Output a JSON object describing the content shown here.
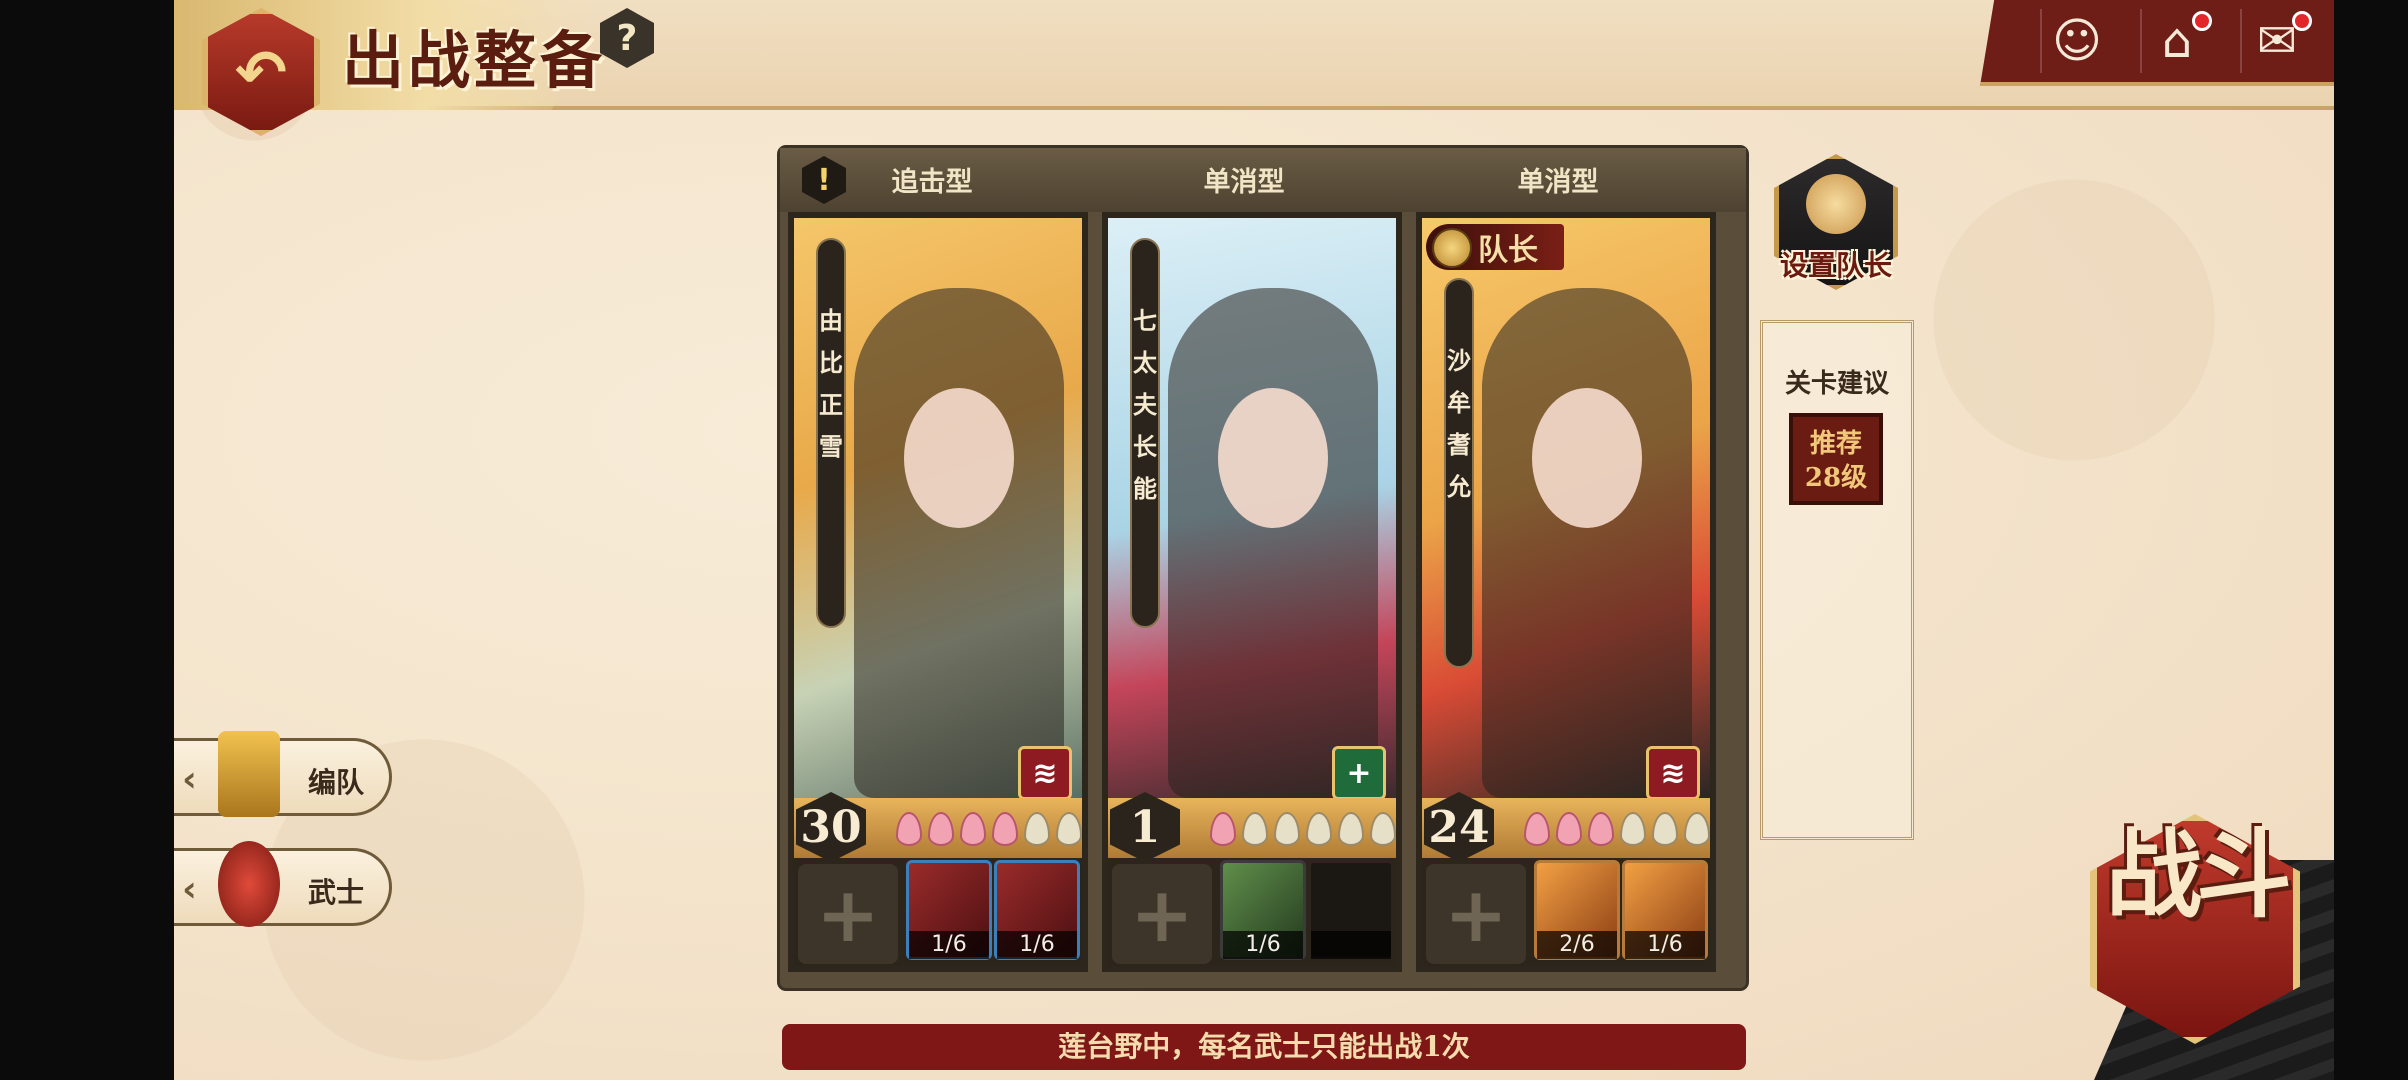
{
  "header": {
    "title": "出战整备",
    "back_icon": "back-arrow-icon",
    "help_label": "?",
    "colors": {
      "accent": "#7a1a12",
      "gold": "#d9b46a"
    }
  },
  "top_right": {
    "icons": [
      {
        "name": "character-icon",
        "badge": false
      },
      {
        "name": "home-upgrade-icon",
        "badge": true
      },
      {
        "name": "mail-icon",
        "badge": true
      }
    ]
  },
  "team": {
    "warning_label": "!",
    "columns": [
      {
        "type_label": "追击型",
        "name_chars": [
          "由",
          "比",
          "正",
          "雪"
        ],
        "level": "30",
        "petals_on": 4,
        "petals_total": 6,
        "badge_icon": "claw-icon",
        "equipment": [
          {
            "style": "red",
            "count": "1/6"
          },
          {
            "style": "red",
            "count": "1/6"
          }
        ]
      },
      {
        "type_label": "单消型",
        "name_chars": [
          "七",
          "太",
          "夫",
          "长",
          "能"
        ],
        "level": "1",
        "petals_on": 1,
        "petals_total": 6,
        "badge_icon": "plus-icon",
        "equipment": [
          {
            "style": "green",
            "count": "1/6"
          },
          {
            "style": "empty",
            "count": ""
          }
        ]
      },
      {
        "type_label": "单消型",
        "name_chars": [
          "沙",
          "牟",
          "耆",
          "允"
        ],
        "level": "24",
        "petals_on": 3,
        "petals_total": 6,
        "badge_icon": "claw-icon",
        "captain_label": "队长",
        "equipment": [
          {
            "style": "orange",
            "count": "2/6"
          },
          {
            "style": "orange",
            "count": "1/6"
          }
        ]
      }
    ]
  },
  "captain_button": {
    "label": "设置队长"
  },
  "advice": {
    "title": "关卡建议",
    "badge_line1": "推荐",
    "badge_line2": "28级"
  },
  "side_buttons": [
    {
      "label": "编队",
      "icon": "banner-icon"
    },
    {
      "label": "武士",
      "icon": "samurai-icon"
    }
  ],
  "notice": "莲台野中，每名武士只能出战1次",
  "battle_button": {
    "label": "战斗"
  }
}
